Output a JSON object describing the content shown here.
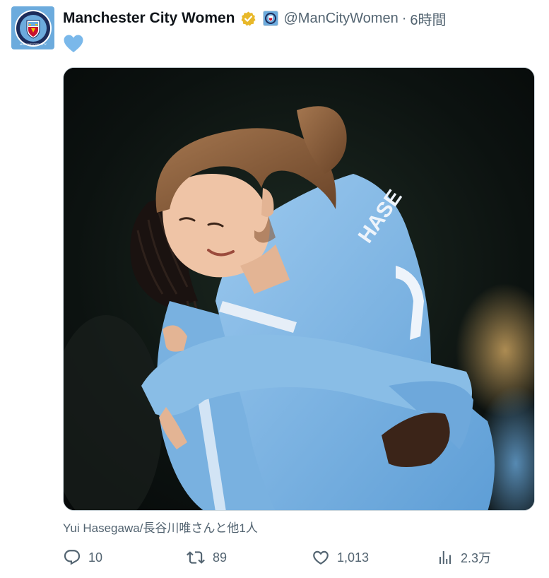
{
  "tweet": {
    "display_name": "Manchester City Women",
    "handle": "@ManCityWomen",
    "separator": "·",
    "time": "6時間",
    "text": "💙",
    "caption": "Yui Hasegawa/長谷川唯さんと他1人"
  },
  "avatar": {
    "icon": "man-city-crest-icon",
    "crest_text": "MANCHESTER CITY"
  },
  "badges": {
    "verified_icon": "verified-gold-badge-icon",
    "affiliate_icon": "man-city-affiliate-icon",
    "verified_color": "#e8b829",
    "brand_color": "#6cabdd"
  },
  "image": {
    "jersey_text": "HASE"
  },
  "actions": {
    "reply": {
      "icon": "reply-icon",
      "count": "10"
    },
    "retweet": {
      "icon": "retweet-icon",
      "count": "89"
    },
    "like": {
      "icon": "heart-icon",
      "count": "1,013"
    },
    "views": {
      "icon": "views-chart-icon",
      "count": "2.3万"
    }
  }
}
